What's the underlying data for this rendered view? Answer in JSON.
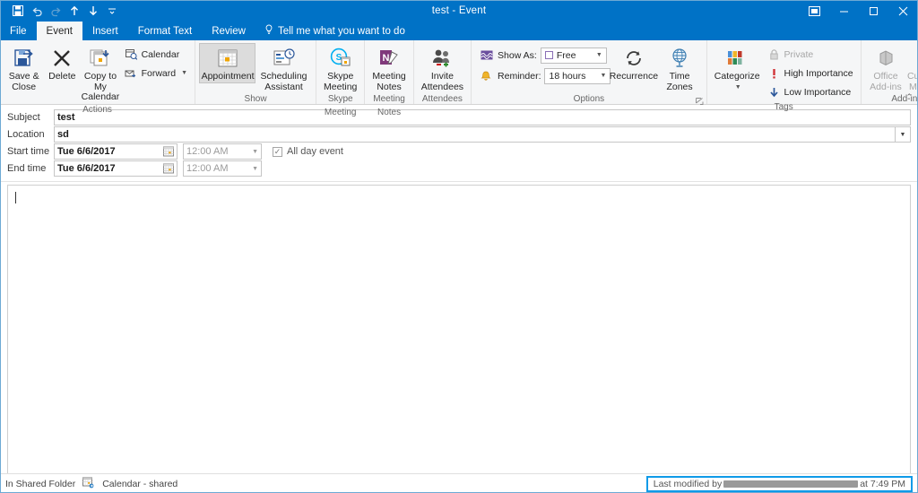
{
  "window": {
    "title": "test  -  Event",
    "accent": "#0072c6",
    "quick_access": [
      {
        "name": "save-icon",
        "label": "Save"
      },
      {
        "name": "undo-icon",
        "label": "Undo"
      },
      {
        "name": "redo-icon",
        "label": "Redo"
      },
      {
        "name": "previous-item-icon",
        "label": "Previous Item"
      },
      {
        "name": "next-item-icon",
        "label": "Next Item"
      },
      {
        "name": "customize-qat-icon",
        "label": "Customize Quick Access Toolbar"
      }
    ],
    "controls": [
      {
        "name": "ribbon-display-options",
        "label": "Ribbon Display Options"
      },
      {
        "name": "minimize",
        "label": "Minimize"
      },
      {
        "name": "maximize",
        "label": "Maximize"
      },
      {
        "name": "close",
        "label": "Close"
      }
    ]
  },
  "tabs": [
    {
      "label": "File",
      "active": false
    },
    {
      "label": "Event",
      "active": true
    },
    {
      "label": "Insert",
      "active": false
    },
    {
      "label": "Format Text",
      "active": false
    },
    {
      "label": "Review",
      "active": false
    }
  ],
  "tell_me": "Tell me what you want to do",
  "ribbon": {
    "collapse_chevron": "⌃",
    "groups": [
      {
        "name": "actions",
        "label": "Actions",
        "big_buttons": [
          {
            "label": "Save & Close",
            "icon": "save-close-icon",
            "disabled": false
          },
          {
            "label": "Delete",
            "icon": "delete-x-icon",
            "disabled": false
          },
          {
            "label": "Copy to My Calendar",
            "icon": "copy-calendar-icon",
            "disabled": false
          }
        ],
        "small_buttons": [
          {
            "label": "Calendar",
            "icon": "calendar-search-icon",
            "caret": false
          },
          {
            "label": "Forward",
            "icon": "forward-mail-icon",
            "caret": true
          }
        ]
      },
      {
        "name": "show",
        "label": "Show",
        "big_buttons": [
          {
            "label": "Appointment",
            "icon": "appointment-icon",
            "selected": true
          },
          {
            "label": "Scheduling Assistant",
            "icon": "scheduling-assistant-icon",
            "selected": false
          }
        ]
      },
      {
        "name": "skype-meeting",
        "label": "Skype Meeting",
        "big_buttons": [
          {
            "label": "Skype Meeting",
            "icon": "skype-icon",
            "disabled": false
          }
        ]
      },
      {
        "name": "meeting-notes",
        "label": "Meeting Notes",
        "big_buttons": [
          {
            "label": "Meeting Notes",
            "icon": "onenote-icon",
            "disabled": false
          }
        ]
      },
      {
        "name": "attendees",
        "label": "Attendees",
        "big_buttons": [
          {
            "label": "Invite Attendees",
            "icon": "invite-attendees-icon",
            "disabled": false
          }
        ]
      },
      {
        "name": "options",
        "label": "Options",
        "has_dialog_launcher": true,
        "fields": [
          {
            "name": "show-as",
            "label": "Show As:",
            "value": "Free",
            "icon": "show-as-icon"
          },
          {
            "name": "reminder",
            "label": "Reminder:",
            "value": "18 hours",
            "icon": "reminder-bell-icon"
          }
        ],
        "big_buttons": [
          {
            "label": "Recurrence",
            "icon": "recurrence-icon",
            "disabled": false
          },
          {
            "label": "Time Zones",
            "icon": "time-zones-icon",
            "disabled": false
          }
        ]
      },
      {
        "name": "tags",
        "label": "Tags",
        "big_buttons": [
          {
            "label": "Categorize",
            "icon": "categorize-icon",
            "caret": true
          }
        ],
        "small_buttons": [
          {
            "label": "Private",
            "icon": "lock-icon",
            "disabled": true
          },
          {
            "label": "High Importance",
            "icon": "high-importance-icon",
            "disabled": false
          },
          {
            "label": "Low Importance",
            "icon": "low-importance-icon",
            "disabled": false
          }
        ]
      },
      {
        "name": "add-ins",
        "label": "Add-ins",
        "big_buttons": [
          {
            "label": "Office Add-ins",
            "icon": "office-addins-icon",
            "disabled": true
          },
          {
            "label": "Customer Manager",
            "icon": "customer-manager-icon",
            "disabled": true
          }
        ]
      }
    ]
  },
  "form": {
    "subject": {
      "label": "Subject",
      "value": "test"
    },
    "location": {
      "label": "Location",
      "value": "sd"
    },
    "start_time": {
      "label": "Start time",
      "date": "Tue 6/6/2017",
      "time": "12:00 AM"
    },
    "end_time": {
      "label": "End time",
      "date": "Tue 6/6/2017",
      "time": "12:00 AM"
    },
    "all_day": {
      "label": "All day event",
      "checked": true,
      "check_glyph": "✓"
    }
  },
  "body": {
    "value": ""
  },
  "status": {
    "shared_folder": "In Shared Folder",
    "folder_icon": "shared-calendar-icon",
    "folder_name": "Calendar - shared",
    "last_modified_prefix": "Last modified by",
    "last_modified_suffix": "at 7:49 PM",
    "highlight_color": "#0f9ae8"
  }
}
